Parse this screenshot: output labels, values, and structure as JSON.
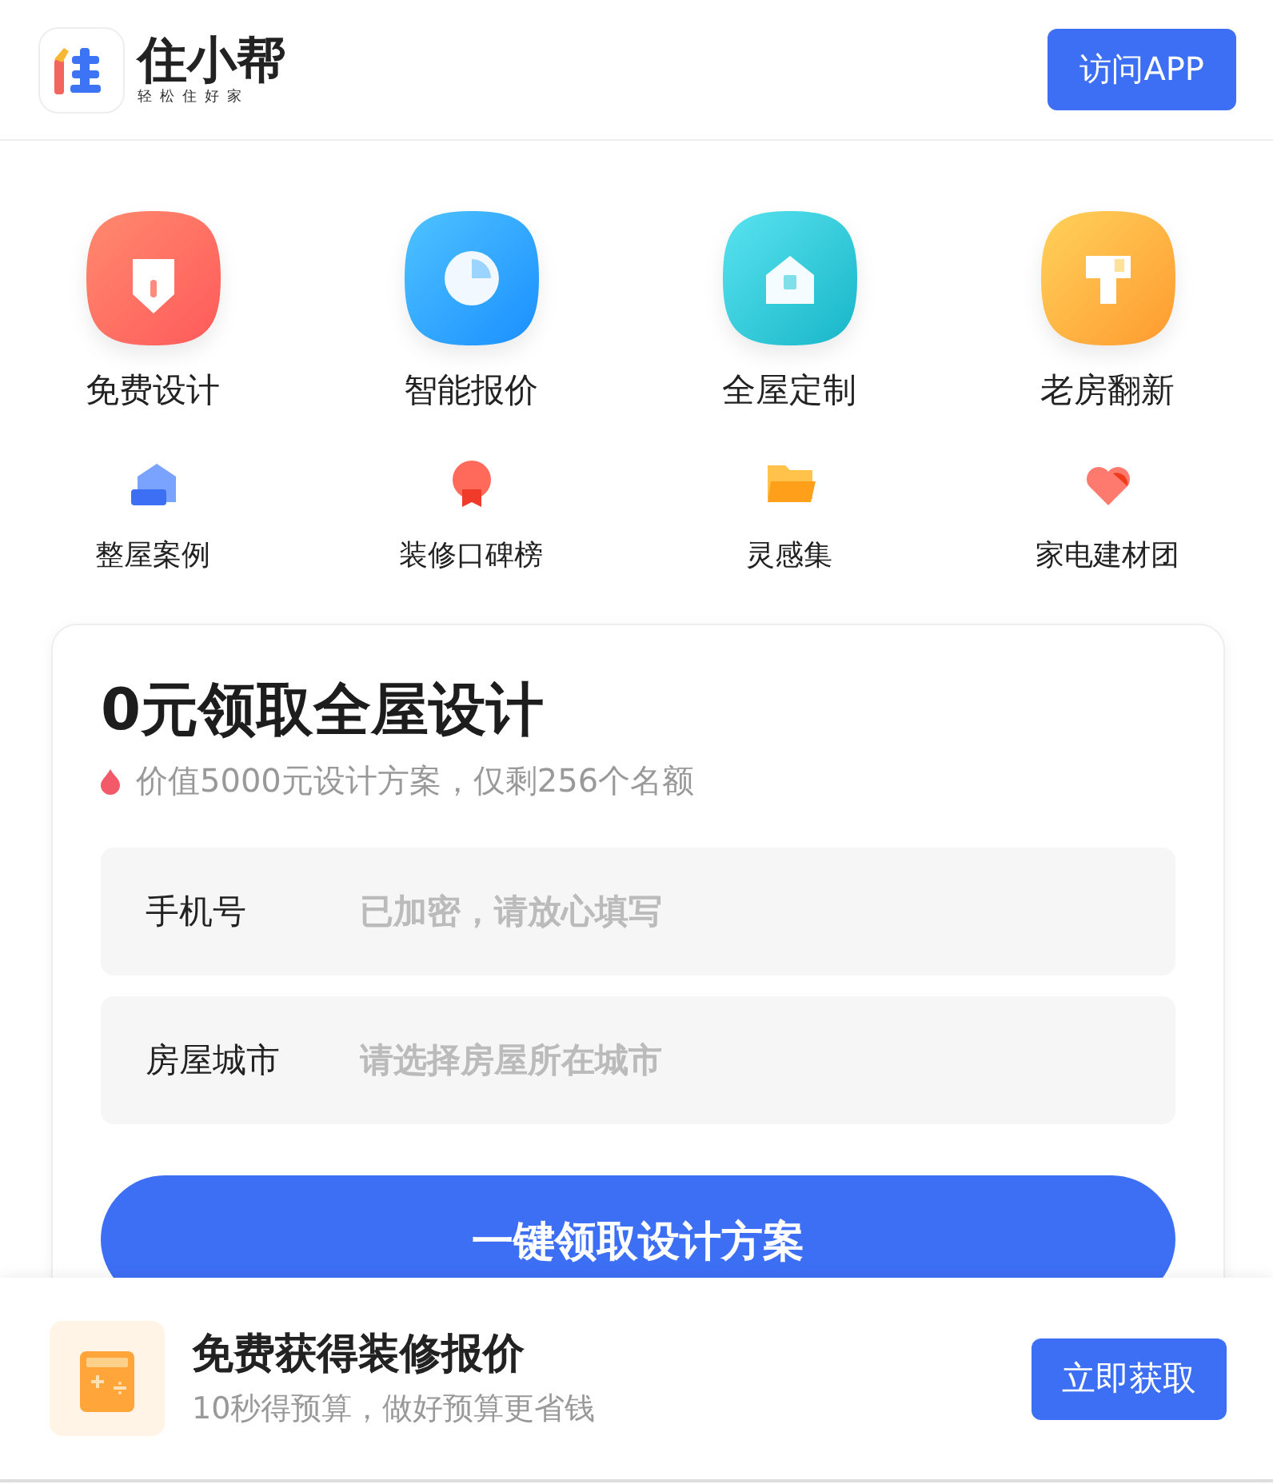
{
  "header": {
    "brand_name": "住小帮",
    "brand_slogan": "轻松住好家",
    "app_button": "访问APP"
  },
  "main_services": [
    {
      "label": "免费设计",
      "kind": "design"
    },
    {
      "label": "智能报价",
      "kind": "quote"
    },
    {
      "label": "全屋定制",
      "kind": "custom"
    },
    {
      "label": "老房翻新",
      "kind": "renovate"
    }
  ],
  "sub_services": [
    {
      "label": "整屋案例",
      "kind": "house"
    },
    {
      "label": "装修口碑榜",
      "kind": "medal"
    },
    {
      "label": "灵感集",
      "kind": "folder"
    },
    {
      "label": "家电建材团",
      "kind": "heart"
    }
  ],
  "form_card": {
    "title": "0元领取全屋设计",
    "subtitle": "价值5000元设计方案，仅剩256个名额",
    "fields": [
      {
        "label": "手机号",
        "placeholder": "已加密，请放心填写"
      },
      {
        "label": "房屋城市",
        "placeholder": "请选择房屋所在城市"
      }
    ],
    "submit": "一键领取设计方案"
  },
  "bottom_bar": {
    "title": "免费获得装修报价",
    "subtitle": "10秒得预算，做好预算更省钱",
    "button": "立即获取"
  }
}
